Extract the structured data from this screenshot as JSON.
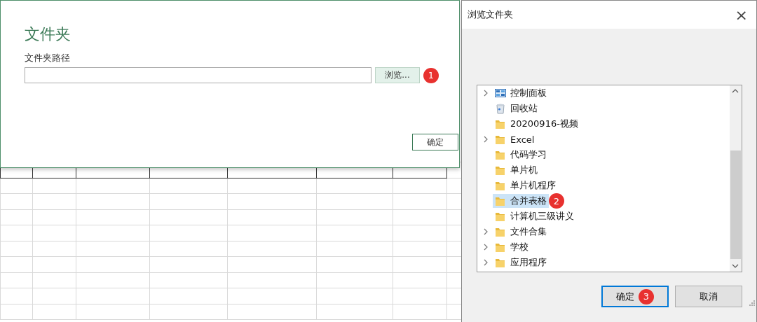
{
  "folder_dialog": {
    "title": "文件夹",
    "path_label": "文件夹路径",
    "browse_button": "浏览...",
    "browse_badge": "1",
    "ok_button": "确定"
  },
  "browse_dialog": {
    "title": "浏览文件夹",
    "close": "×",
    "tree": [
      {
        "label": "控制面板",
        "kind": "control-panel",
        "expandable": true,
        "selected": false
      },
      {
        "label": "回收站",
        "kind": "recycle-bin",
        "expandable": false,
        "selected": false
      },
      {
        "label": "20200916-视频",
        "kind": "folder",
        "expandable": false,
        "selected": false
      },
      {
        "label": "Excel",
        "kind": "folder",
        "expandable": true,
        "selected": false
      },
      {
        "label": "代码学习",
        "kind": "folder",
        "expandable": false,
        "selected": false
      },
      {
        "label": "单片机",
        "kind": "folder",
        "expandable": false,
        "selected": false
      },
      {
        "label": "单片机程序",
        "kind": "folder",
        "expandable": false,
        "selected": false
      },
      {
        "label": "合并表格",
        "kind": "folder",
        "expandable": false,
        "selected": true,
        "badge": "2"
      },
      {
        "label": "计算机三级讲义",
        "kind": "folder",
        "expandable": false,
        "selected": false
      },
      {
        "label": "文件合集",
        "kind": "folder",
        "expandable": true,
        "selected": false
      },
      {
        "label": "学校",
        "kind": "folder",
        "expandable": true,
        "selected": false
      },
      {
        "label": "应用程序",
        "kind": "folder",
        "expandable": true,
        "selected": false
      }
    ],
    "buttons": [
      {
        "label": "确定",
        "focused": true,
        "badge": "3"
      },
      {
        "label": "取消",
        "focused": false
      }
    ]
  }
}
